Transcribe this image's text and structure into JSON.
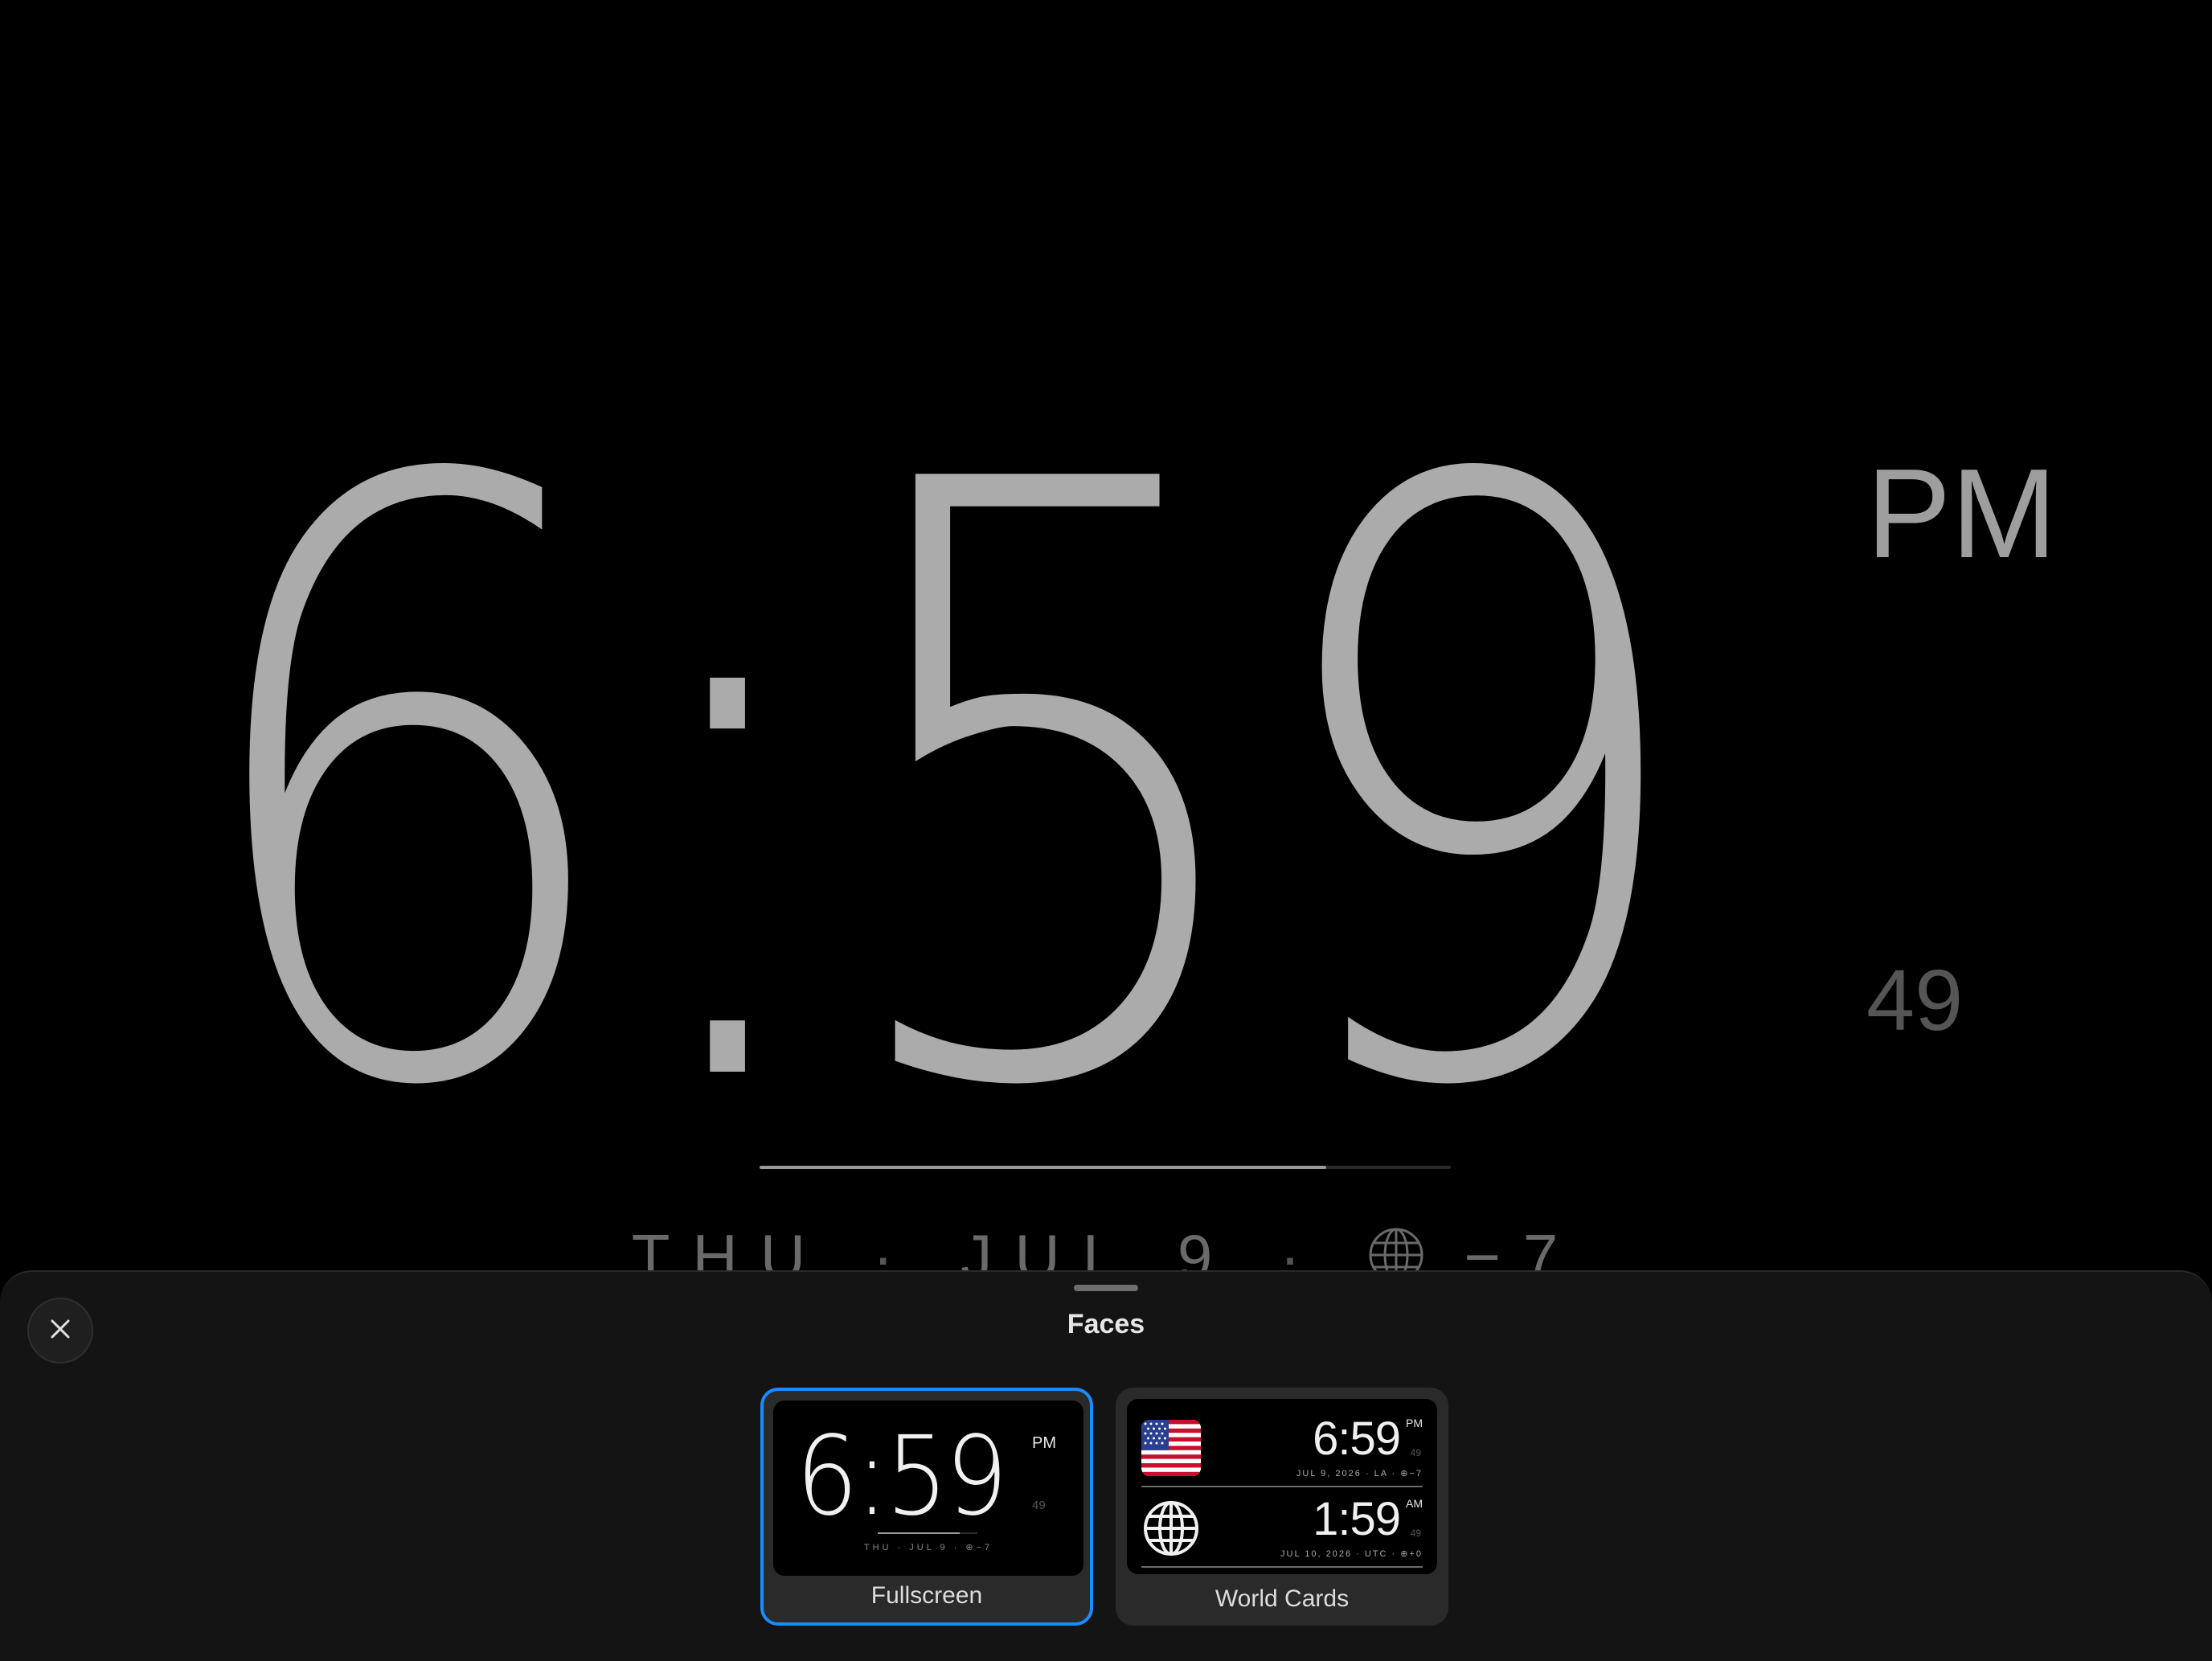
{
  "clock": {
    "time": "6:59",
    "ampm": "PM",
    "seconds": "49",
    "minute_progress": 0.82,
    "day": "THU",
    "date": "JUL 9",
    "offset": "−7",
    "separator": "·"
  },
  "sheet": {
    "title": "Faces",
    "close_icon": "close-icon"
  },
  "faces": [
    {
      "label": "Fullscreen",
      "selected": true,
      "time": "6:59",
      "ampm": "PM",
      "seconds": "49",
      "date_line": "THU · JUL 9 · ⊕−7"
    },
    {
      "label": "World Cards",
      "selected": false,
      "cards": [
        {
          "icon": "us-flag-icon",
          "time": "6:59",
          "ampm": "PM",
          "seconds": "49",
          "sub": "JUL 9, 2026 · LA · ⊕−7"
        },
        {
          "icon": "globe-icon",
          "time": "1:59",
          "ampm": "AM",
          "seconds": "49",
          "sub": "JUL 10, 2026 · UTC · ⊕+0"
        }
      ]
    }
  ],
  "colors": {
    "accent": "#1a8cff",
    "background": "#000000",
    "sheet": "#141414",
    "clock_digits": "#ababab"
  }
}
